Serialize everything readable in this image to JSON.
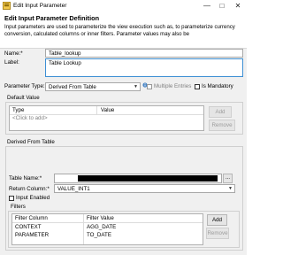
{
  "window": {
    "title": "Edit Input Parameter",
    "controls": [
      "—",
      "□",
      "✕"
    ]
  },
  "header": {
    "title": "Edit Input Parameter Definition",
    "description": "Input parameters are used to parameterize the view execution such as, to parameterize currency conversion, calculated columns or inner filters. Parameter values may also be"
  },
  "form": {
    "name_label": "Name:*",
    "name_value": "Table_lookup",
    "label_label": "Label:",
    "label_value": "Table Lookup",
    "parameter_type_label": "Parameter Type:",
    "parameter_type_value": "Derived From Table",
    "multiple_entries_label": "Multiple Entries",
    "is_mandatory_label": "Is Mandatory"
  },
  "default_value": {
    "group_label": "Default Value",
    "columns": [
      "Type",
      "Value"
    ],
    "placeholder_row": "<Click to add>",
    "add_button": "Add",
    "remove_button": "Remove"
  },
  "derived": {
    "group_label": "Derived From Table",
    "table_name_label": "Table Name:*",
    "browse_label": "...",
    "return_column_label": "Return Column:*",
    "return_column_value": "VALUE_INT1",
    "input_enabled_label": "Input Enabled"
  },
  "filters": {
    "group_label": "Filters",
    "columns": [
      "Filter Column",
      "Filter Value"
    ],
    "rows": [
      {
        "column": "CONTEXT",
        "value": "AGG_DATE"
      },
      {
        "column": "PARAMETER",
        "value": "TO_DATE"
      }
    ],
    "add_button": "Add",
    "remove_button": "Remove"
  },
  "colors": {
    "focus_border": "#3e90d4",
    "dialog_bg": "#f0f0f0",
    "redaction": "#000000"
  }
}
